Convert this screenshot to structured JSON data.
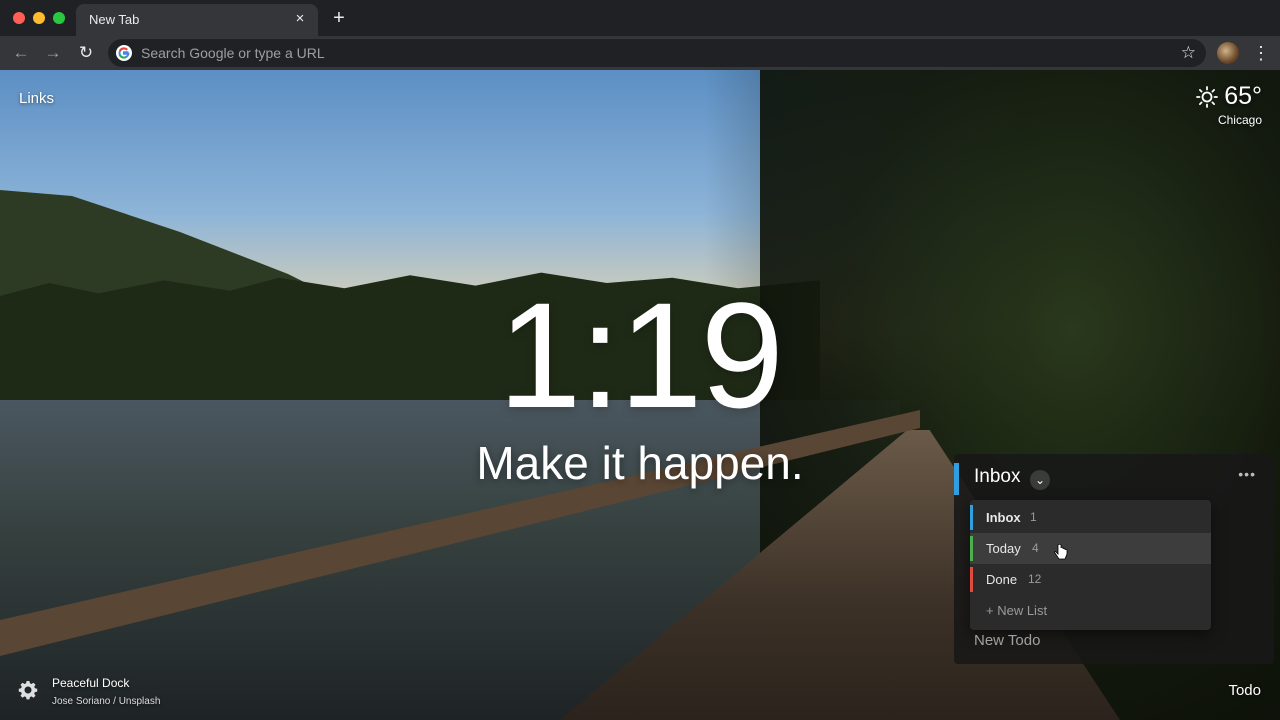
{
  "browser": {
    "tab_title": "New Tab",
    "tab_close": "×",
    "new_tab": "+",
    "omnibox_placeholder": "Search Google or type a URL"
  },
  "page": {
    "links_label": "Links",
    "weather": {
      "temperature": "65°",
      "city": "Chicago"
    },
    "clock": "1:19",
    "mantra": "Make it happen.",
    "photo": {
      "title": "Peaceful Dock",
      "credit": "Jose Soriano / Unsplash"
    },
    "todo_button": "Todo"
  },
  "todo": {
    "current_list": "Inbox",
    "more_label": "•••",
    "lists": [
      {
        "name": "Inbox",
        "count": "1",
        "color": "#2f9fe0"
      },
      {
        "name": "Today",
        "count": "4",
        "color": "#4caf50"
      },
      {
        "name": "Done",
        "count": "12",
        "color": "#e04a3f"
      }
    ],
    "new_list_label": "+ New List",
    "new_todo_placeholder": "New Todo"
  }
}
